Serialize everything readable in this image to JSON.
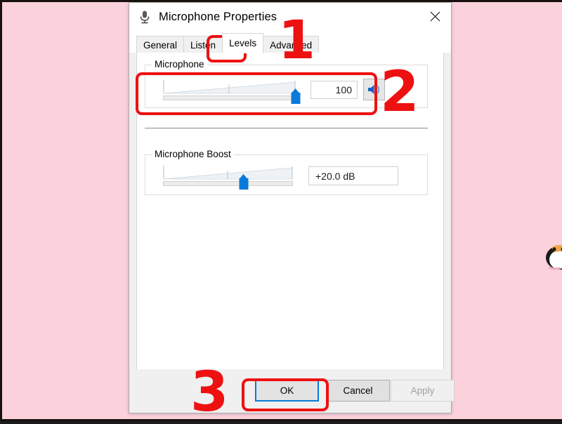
{
  "background": {
    "color": "#fbd2dc",
    "mascot": "penguin-mascot"
  },
  "dialog": {
    "titlebar": {
      "icon": "microphone-icon",
      "title": "Microphone Properties",
      "close_label": "close-icon"
    },
    "tabs": [
      {
        "label": "General",
        "selected": false
      },
      {
        "label": "Listen",
        "selected": false
      },
      {
        "label": "Levels",
        "selected": true
      },
      {
        "label": "Advanced",
        "selected": false
      }
    ],
    "levels_page": {
      "microphone_group": {
        "legend": "Microphone",
        "slider": {
          "value": 100,
          "min": 0,
          "max": 100,
          "percent": 100
        },
        "value_text": "100",
        "mute_button_icon": "speaker-icon"
      },
      "boost_group": {
        "legend": "Microphone Boost",
        "slider": {
          "value": 20.0,
          "min": 0,
          "max": 30,
          "percent": 62
        },
        "value_text": "+20.0 dB"
      }
    },
    "footer": {
      "ok_label": "OK",
      "cancel_label": "Cancel",
      "apply_label": "Apply",
      "apply_enabled": false
    }
  },
  "annotations": {
    "accent_color": "#ee1111",
    "markers": [
      {
        "number": "1",
        "target": "levels-tab"
      },
      {
        "number": "2",
        "target": "microphone-volume-slider"
      },
      {
        "number": "3",
        "target": "ok-button"
      }
    ]
  }
}
